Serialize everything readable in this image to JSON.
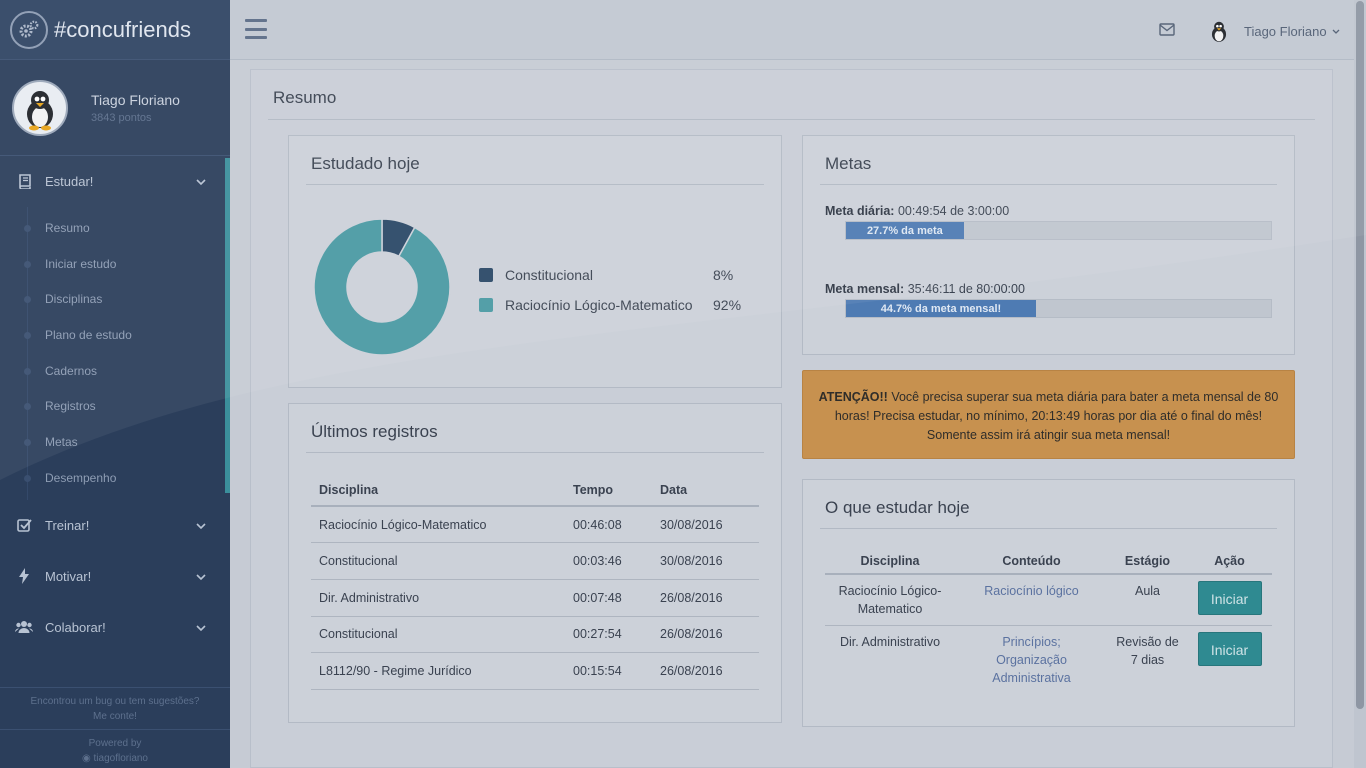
{
  "brand": {
    "name": "#concufriends"
  },
  "profile": {
    "name": "Tiago Floriano",
    "points": "3843 pontos"
  },
  "sidebar": {
    "menus": [
      {
        "label": "Estudar!"
      },
      {
        "label": "Treinar!"
      },
      {
        "label": "Motivar!"
      },
      {
        "label": "Colaborar!"
      }
    ],
    "subitems": [
      "Resumo",
      "Iniciar estudo",
      "Disciplinas",
      "Plano de estudo",
      "Cadernos",
      "Registros",
      "Metas",
      "Desempenho"
    ],
    "footer": {
      "bug_line1": "Encontrou um bug ou tem sugestões?",
      "bug_line2": "Me conte!",
      "powered": "Powered by",
      "github": "tiagofloriano"
    }
  },
  "topbar": {
    "user_name": "Tiago Floriano"
  },
  "page": {
    "title": "Resumo"
  },
  "studied_today": {
    "title": "Estudado hoje",
    "chart_data": {
      "type": "pie",
      "categories": [
        "Constitucional",
        "Raciocínio Lógico-Matematico"
      ],
      "values": [
        8,
        92
      ],
      "colors": [
        "#2a4866",
        "#4a9aa3"
      ],
      "labels": [
        "8%",
        "92%"
      ]
    }
  },
  "recent": {
    "title": "Últimos registros",
    "headers": [
      "Disciplina",
      "Tempo",
      "Data"
    ],
    "rows": [
      [
        "Raciocínio Lógico-Matematico",
        "00:46:08",
        "30/08/2016"
      ],
      [
        "Constitucional",
        "00:03:46",
        "30/08/2016"
      ],
      [
        "Dir. Administrativo",
        "00:07:48",
        "26/08/2016"
      ],
      [
        "Constitucional",
        "00:27:54",
        "26/08/2016"
      ],
      [
        "L8112/90 - Regime Jurídico",
        "00:15:54",
        "26/08/2016"
      ]
    ]
  },
  "goals": {
    "title": "Metas",
    "daily_label": "Meta diária:",
    "daily_value": "00:49:54 de 3:00:00",
    "daily_bar_text": "27.7% da meta",
    "daily_progress": 0.277,
    "monthly_label": "Meta mensal:",
    "monthly_value": "35:46:11 de 80:00:00",
    "monthly_bar_text": "44.7% da meta mensal!",
    "monthly_progress": 0.447
  },
  "alert": {
    "strong": "ATENÇÃO!!",
    "text": " Você precisa superar sua meta diária para bater a meta mensal de 80 horas! Precisa estudar, no mínimo, 20:13:49 horas por dia até o final do mês! Somente assim irá atingir sua meta mensal!"
  },
  "today": {
    "title": "O que estudar hoje",
    "headers": [
      "Disciplina",
      "Conteúdo",
      "Estágio",
      "Ação"
    ],
    "rows": [
      {
        "discipline": "Raciocínio Lógico-Matematico",
        "content": "Raciocínio lógico",
        "stage": "Aula",
        "action": "Iniciar"
      },
      {
        "discipline": "Dir. Administrativo",
        "content": "Princípios; Organização Administrativa",
        "stage": "Revisão de 7 dias",
        "action": "Iniciar"
      }
    ]
  }
}
